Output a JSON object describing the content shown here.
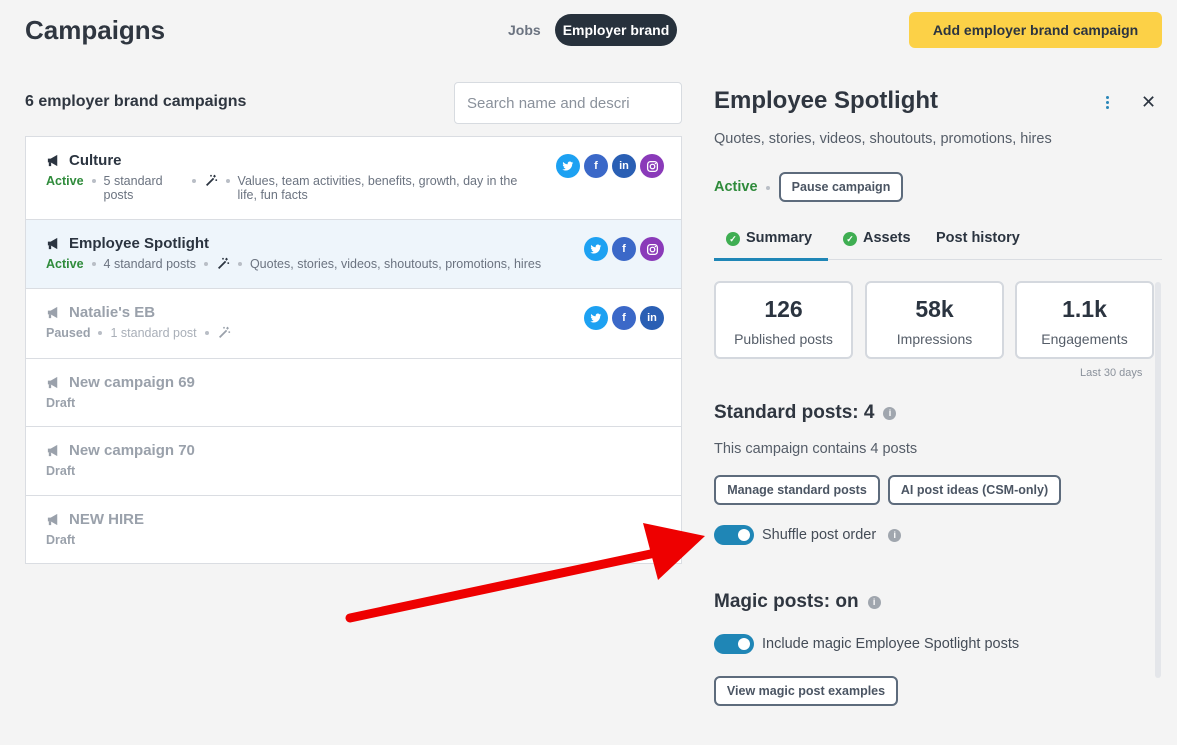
{
  "header": {
    "title": "Campaigns",
    "tabs": [
      {
        "label": "Jobs",
        "active": false
      },
      {
        "label": "Employer brand",
        "active": true
      }
    ],
    "add_button": "Add employer brand campaign"
  },
  "list": {
    "count_label": "6 employer brand campaigns",
    "search_placeholder": "Search name and descri",
    "campaigns": [
      {
        "title": "Culture",
        "status": "Active",
        "posts": "5 standard posts",
        "description": "Values, team activities, benefits, growth, day in the life, fun facts",
        "socials": [
          "twitter",
          "facebook",
          "linkedin",
          "instagram"
        ]
      },
      {
        "title": "Employee Spotlight",
        "status": "Active",
        "posts": "4 standard posts",
        "description": "Quotes, stories, videos, shoutouts, promotions, hires",
        "socials": [
          "twitter",
          "facebook",
          "instagram"
        ]
      },
      {
        "title": "Natalie's EB",
        "status": "Paused",
        "posts": "1 standard post",
        "description": "",
        "socials": [
          "twitter",
          "facebook",
          "linkedin"
        ]
      },
      {
        "title": "New campaign 69",
        "status": "Draft"
      },
      {
        "title": "New campaign 70",
        "status": "Draft"
      },
      {
        "title": "NEW HIRE",
        "status": "Draft"
      }
    ]
  },
  "detail": {
    "title": "Employee Spotlight",
    "description": "Quotes, stories, videos, shoutouts, promotions, hires",
    "status": "Active",
    "pause_button": "Pause campaign",
    "tabs": [
      {
        "label": "Summary",
        "checked": true,
        "active": true
      },
      {
        "label": "Assets",
        "checked": true,
        "active": false
      },
      {
        "label": "Post history",
        "checked": false,
        "active": false
      }
    ],
    "stats": [
      {
        "value": "126",
        "label": "Published posts"
      },
      {
        "value": "58k",
        "label": "Impressions"
      },
      {
        "value": "1.1k",
        "label": "Engagements"
      }
    ],
    "stats_period": "Last 30 days",
    "standard": {
      "heading": "Standard posts: 4",
      "text": "This campaign contains 4 posts",
      "manage_button": "Manage standard posts",
      "ai_button": "AI post ideas (CSM-only)",
      "shuffle_label": "Shuffle post order",
      "shuffle_on": true
    },
    "magic": {
      "heading": "Magic posts: on",
      "toggle_label": "Include magic Employee Spotlight posts",
      "toggle_on": true,
      "examples_button": "View magic post examples"
    }
  },
  "colors": {
    "accent": "#1f86b6",
    "active_status": "#2f8b3b",
    "primary_button": "#fcd147",
    "annotation_arrow": "#ee0000"
  }
}
